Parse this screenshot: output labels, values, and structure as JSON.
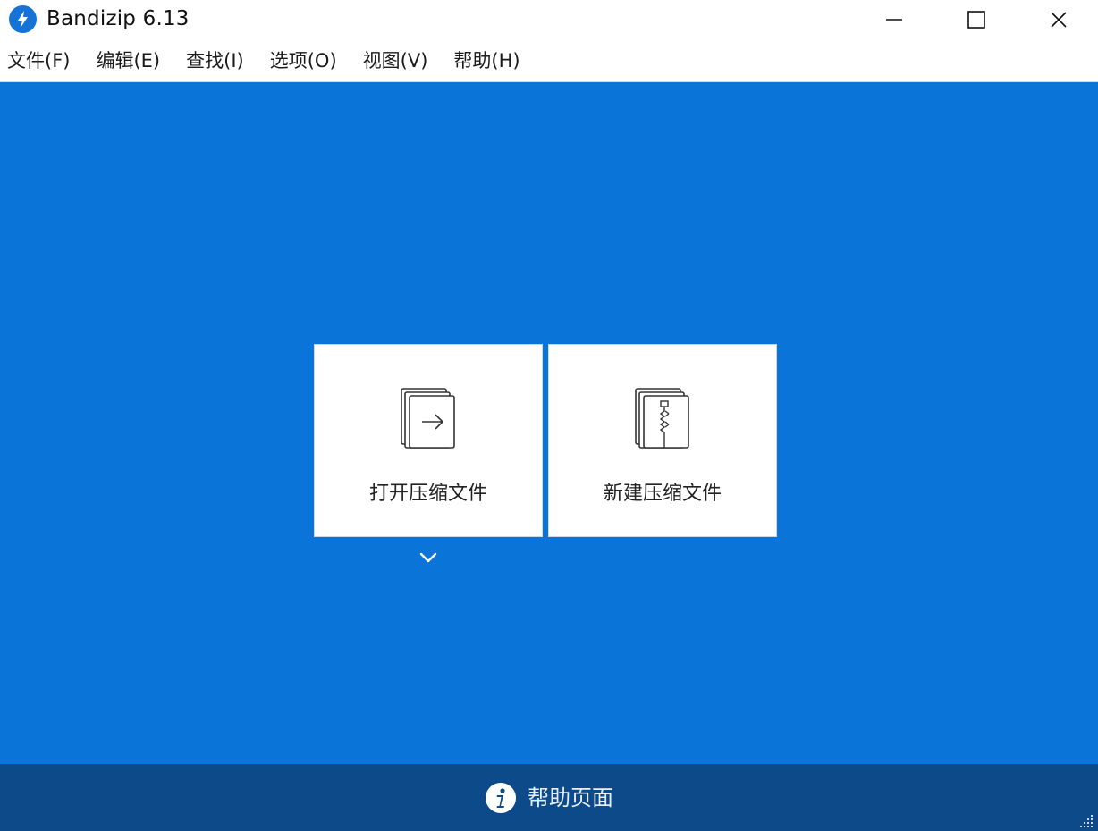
{
  "window": {
    "title": "Bandizip 6.13",
    "icons": {
      "app": "bandizip-logo-icon",
      "minimize": "minimize-icon",
      "maximize": "maximize-icon",
      "close": "close-icon"
    }
  },
  "menu": {
    "items": [
      {
        "label": "文件(F)"
      },
      {
        "label": "编辑(E)"
      },
      {
        "label": "查找(I)"
      },
      {
        "label": "选项(O)"
      },
      {
        "label": "视图(V)"
      },
      {
        "label": "帮助(H)"
      }
    ]
  },
  "main": {
    "cards": [
      {
        "label": "打开压缩文件",
        "icon": "open-archive-icon"
      },
      {
        "label": "新建压缩文件",
        "icon": "new-archive-icon"
      }
    ],
    "dropdown_icon": "chevron-down-icon"
  },
  "footer": {
    "label": "帮助页面",
    "icon": "info-icon"
  },
  "colors": {
    "accent_blue": "#0a74d8",
    "footer_blue": "#0c4a8a",
    "card_bg": "#ffffff"
  }
}
